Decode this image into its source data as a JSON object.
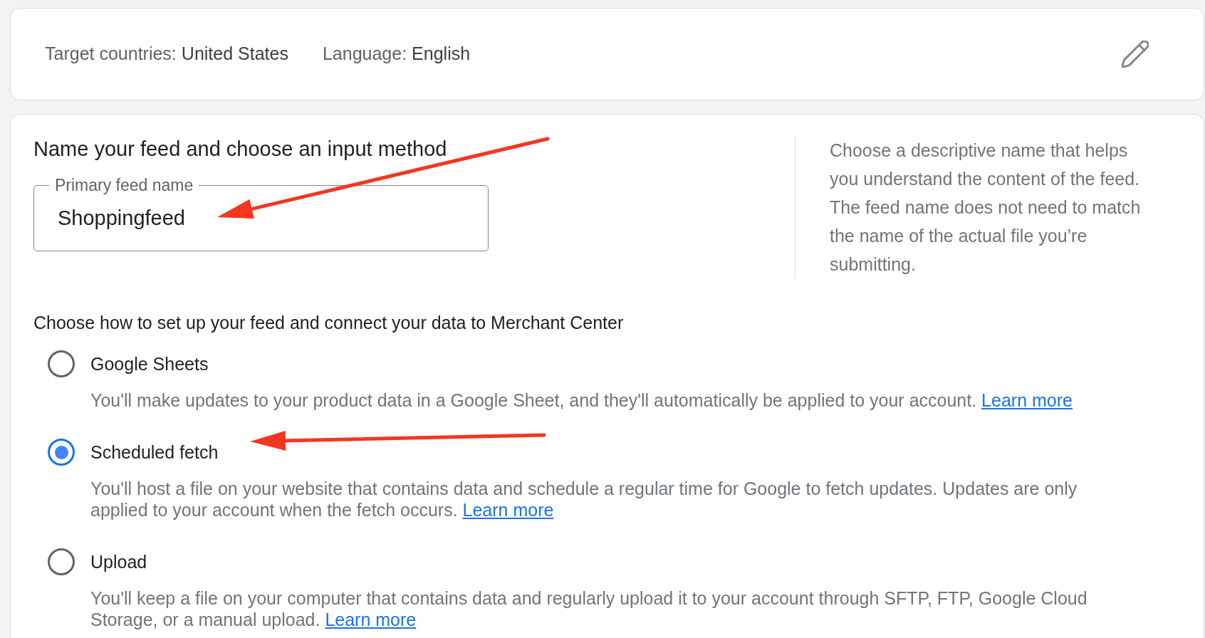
{
  "summary_card": {
    "fields": [
      {
        "label": "Target countries:",
        "value": "United States"
      },
      {
        "label": "Language:",
        "value": "English"
      }
    ]
  },
  "feed_setup": {
    "heading": "Name your feed and choose an input method",
    "feed_name_field": {
      "label": "Primary feed name",
      "value": "Shoppingfeed"
    },
    "help_text": "Choose a descriptive name that helps you understand the content of the feed. The feed name does not need to match the name of the actual file you’re submitting.",
    "input_method": {
      "prompt": "Choose how to set up your feed and connect your data to Merchant Center",
      "options": [
        {
          "label": "Google Sheets",
          "selected": false,
          "description": "You'll make updates to your product data in a Google Sheet, and they'll automatically be applied to your account.",
          "link": "Learn more"
        },
        {
          "label": "Scheduled fetch",
          "selected": true,
          "description": "You'll host a file on your website that contains data and schedule a regular time for Google to fetch updates. Updates are only applied to your account when the fetch occurs.",
          "link": "Learn more"
        },
        {
          "label": "Upload",
          "selected": false,
          "description": "You'll keep a file on your computer that contains data and regularly upload it to your account through SFTP, FTP, Google Cloud Storage, or a manual upload.",
          "link": "Learn more"
        }
      ]
    }
  }
}
